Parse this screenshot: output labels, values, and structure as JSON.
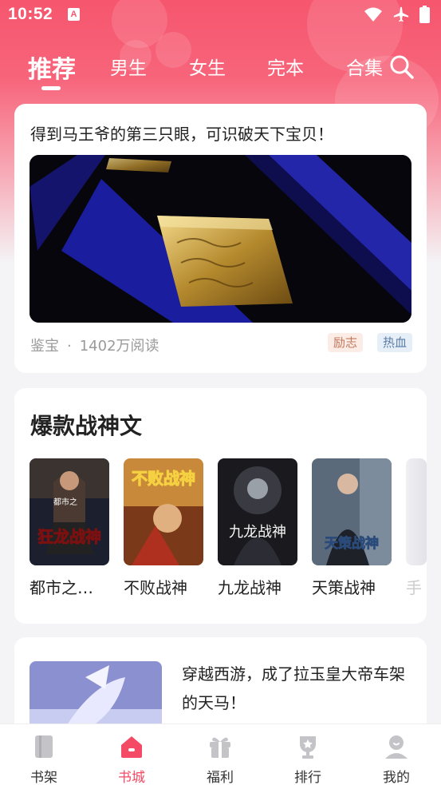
{
  "status_bar": {
    "time": "10:52",
    "badge": "A"
  },
  "nav": {
    "tabs": [
      {
        "label": "推荐",
        "active": true
      },
      {
        "label": "男生",
        "active": false
      },
      {
        "label": "女生",
        "active": false
      },
      {
        "label": "完本",
        "active": false
      },
      {
        "label": "合集",
        "active": false
      }
    ]
  },
  "featured": {
    "title": "得到马王爷的第三只眼，可识破天下宝贝！",
    "category": "鉴宝",
    "separator": "·",
    "reads": "1402万阅读",
    "tags": [
      "励志",
      "热血"
    ]
  },
  "section": {
    "title": "爆款战神文",
    "books": [
      {
        "name": "都市之…",
        "cover_text": "狂龙战神",
        "cover_sub": "都市之"
      },
      {
        "name": "不败战神",
        "cover_text": "不败战神"
      },
      {
        "name": "九龙战神",
        "cover_text": "九龙战神"
      },
      {
        "name": "天策战神",
        "cover_text": "天策战神"
      },
      {
        "name": "手"
      }
    ]
  },
  "recommend": {
    "text": "穿越西游，成了拉玉皇大帝车架的天马！"
  },
  "bottom_nav": [
    {
      "label": "书架",
      "icon": "bookshelf-icon",
      "active": false
    },
    {
      "label": "书城",
      "icon": "home-icon",
      "active": true
    },
    {
      "label": "福利",
      "icon": "gift-icon",
      "active": false
    },
    {
      "label": "排行",
      "icon": "trophy-icon",
      "active": false
    },
    {
      "label": "我的",
      "icon": "profile-icon",
      "active": false
    }
  ],
  "colors": {
    "accent": "#f44a65",
    "header": "#f6566e"
  }
}
